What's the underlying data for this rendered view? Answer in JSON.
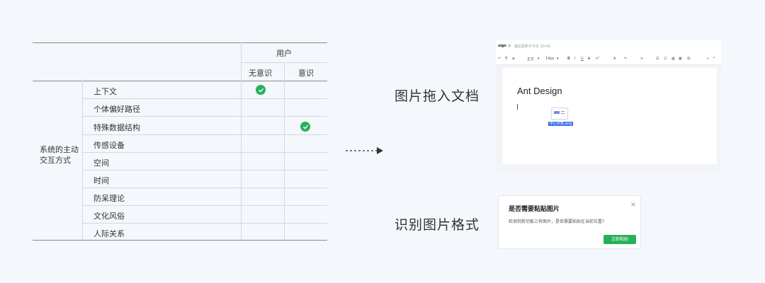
{
  "table": {
    "group_header": "用户",
    "columns": [
      "无意识",
      "意识"
    ],
    "row_group_label_lines": [
      "系统的主动",
      "交互方式"
    ],
    "rows": [
      {
        "label": "上下文",
        "unaware": true,
        "aware": false
      },
      {
        "label": "个体偏好路径",
        "unaware": false,
        "aware": false
      },
      {
        "label": "特殊数据结构",
        "unaware": false,
        "aware": true
      },
      {
        "label": "传感设备",
        "unaware": false,
        "aware": false
      },
      {
        "label": "空间",
        "unaware": false,
        "aware": false
      },
      {
        "label": "时间",
        "unaware": false,
        "aware": false
      },
      {
        "label": "防呆理论",
        "unaware": false,
        "aware": false
      },
      {
        "label": "文化风俗",
        "unaware": false,
        "aware": false
      },
      {
        "label": "人际关系",
        "unaware": false,
        "aware": false
      }
    ]
  },
  "labels": {
    "drag_image": "图片拖入文档",
    "detect_format": "识别图片格式"
  },
  "editor": {
    "title_fragment": "sign",
    "saved_status": "最后更新于今天 10:40",
    "toolbar": {
      "paragraph_style": "正文",
      "font_size": "14px"
    },
    "doc_title": "Ant Design",
    "file_name": "中心示意.png"
  },
  "dialog": {
    "title": "是否需要粘贴图片",
    "body": "检测到剪切板上有图片，是否需要粘贴在当前位置?",
    "confirm_label": "立即粘贴"
  },
  "colors": {
    "check_green": "#27b05a",
    "selection_blue": "#3a6ff0",
    "background": "#f4f7fc"
  },
  "icons": [
    "check-icon",
    "close-icon",
    "arrow-right-icon"
  ]
}
